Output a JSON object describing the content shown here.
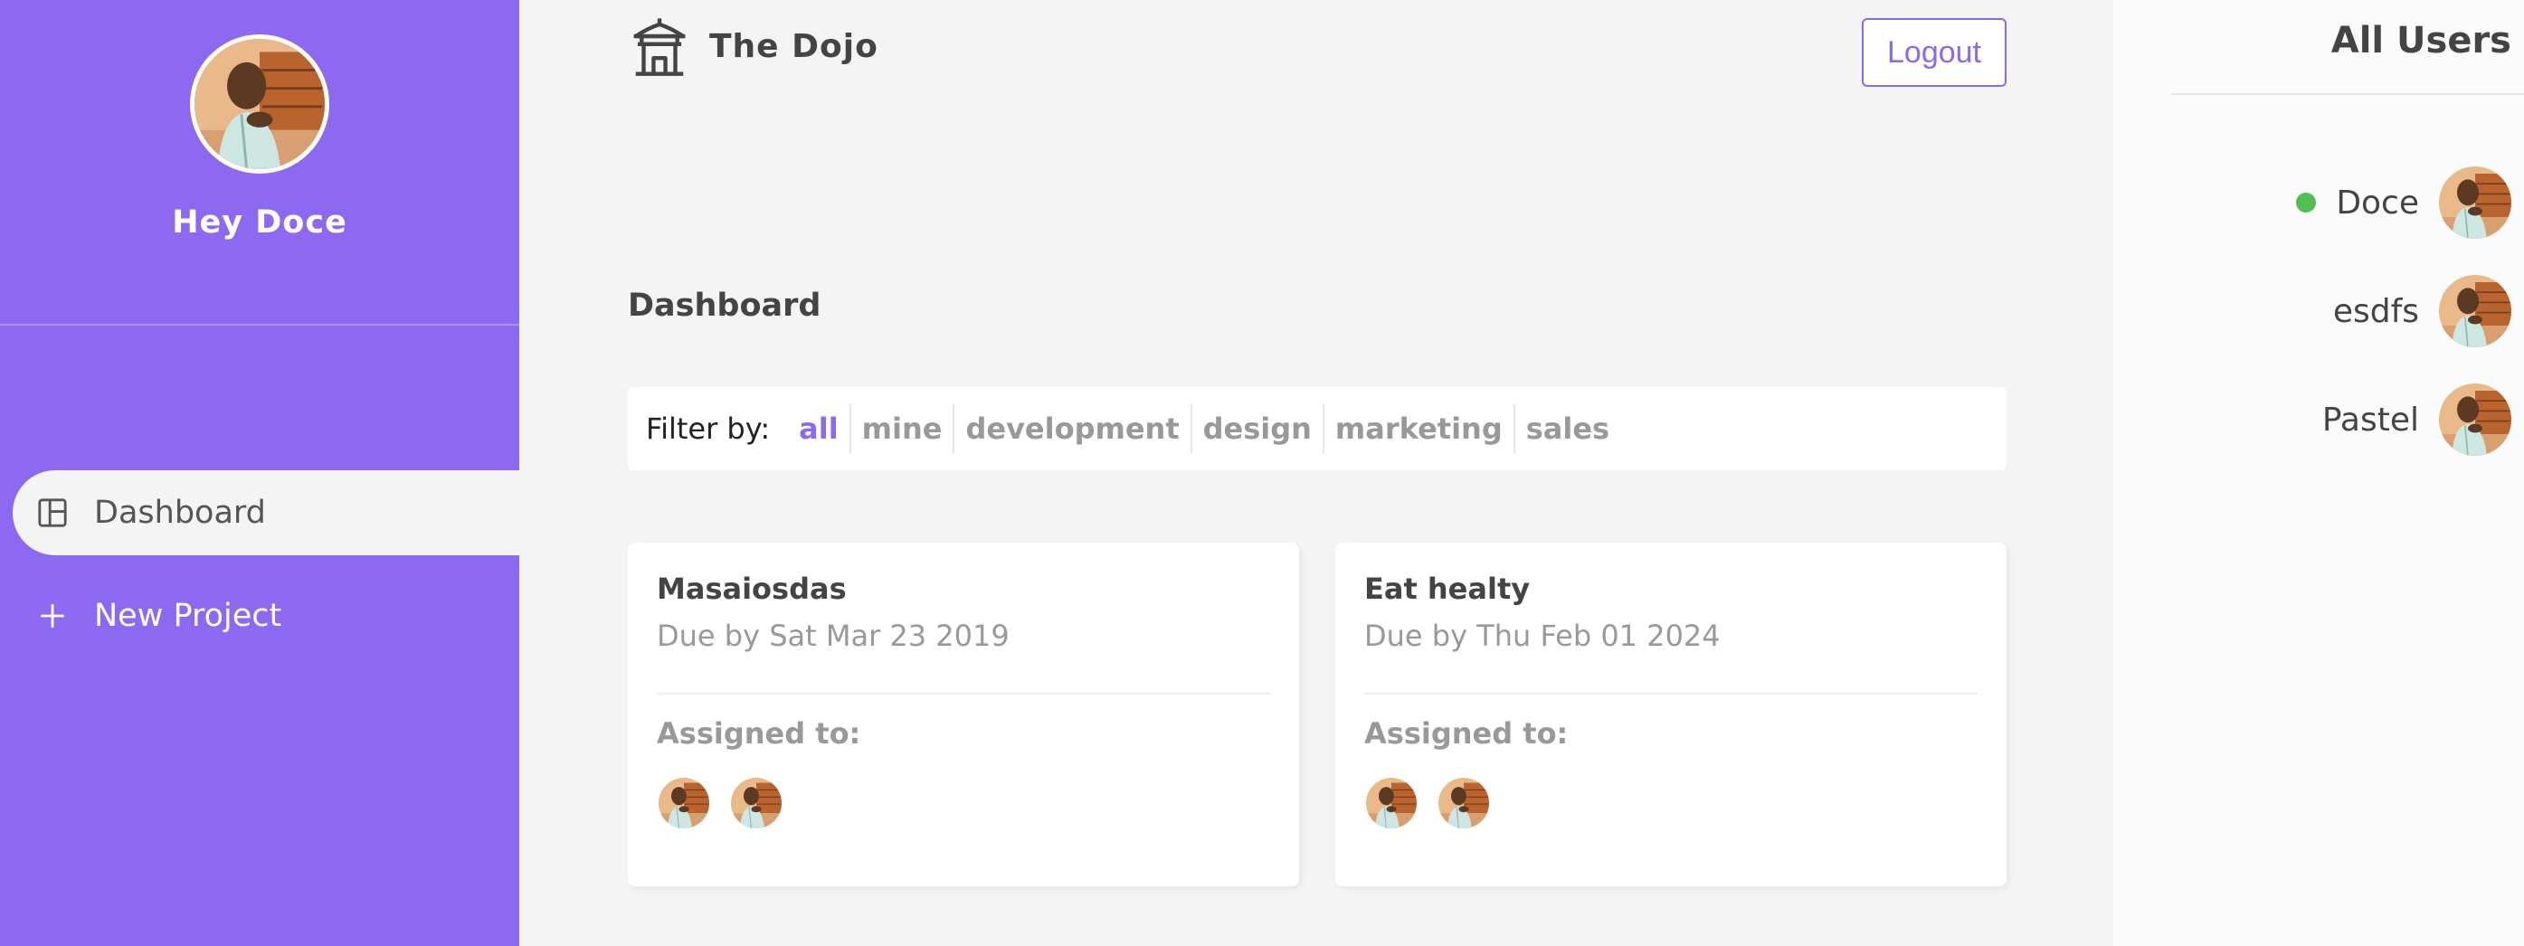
{
  "sidebar": {
    "greeting": "Hey Doce",
    "nav": [
      {
        "label": "Dashboard",
        "icon": "dashboard-icon",
        "active": true
      },
      {
        "label": "New Project",
        "icon": "plus-icon",
        "active": false
      }
    ]
  },
  "navbar": {
    "brand": "The Dojo",
    "logout_label": "Logout"
  },
  "main": {
    "title": "Dashboard",
    "filter": {
      "label": "Filter by:",
      "options": [
        "all",
        "mine",
        "development",
        "design",
        "marketing",
        "sales"
      ],
      "selected": "all"
    },
    "projects": [
      {
        "name": "Masaiosdas",
        "due": "Due by Sat Mar 23 2019",
        "assigned_label": "Assigned to:",
        "assigned_count": 2
      },
      {
        "name": "Eat healty",
        "due": "Due by Thu Feb 01 2024",
        "assigned_label": "Assigned to:",
        "assigned_count": 2
      }
    ]
  },
  "users": {
    "title": "All Users",
    "list": [
      {
        "name": "Doce",
        "online": true
      },
      {
        "name": "esdfs",
        "online": false
      },
      {
        "name": "Pastel",
        "online": false
      }
    ]
  },
  "colors": {
    "accent": "#8d69f1",
    "background": "#f4f4f4",
    "online": "#4fbf4f"
  }
}
